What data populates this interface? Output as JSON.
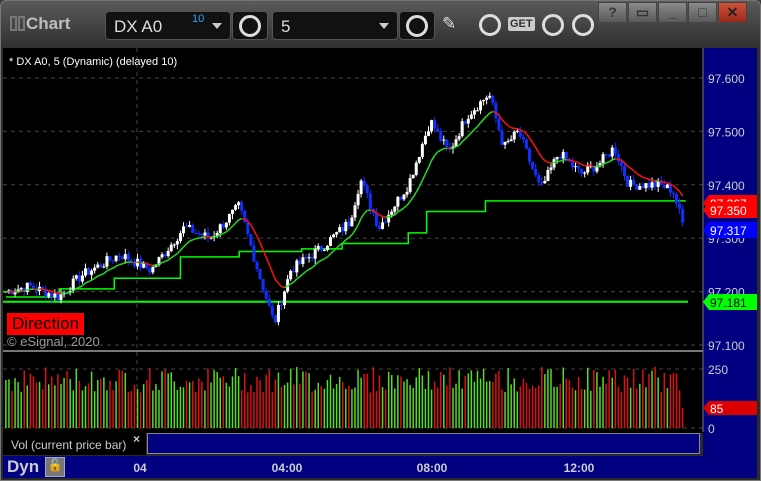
{
  "window": {
    "title": "Chart",
    "symbol": "DX A0",
    "symbol_badge": "10",
    "interval": "5",
    "buttons": [
      "help",
      "restore-down",
      "minimize",
      "maximize",
      "close"
    ],
    "help_label": "?",
    "get_label": "GET"
  },
  "chart": {
    "header": "* DX A0, 5 (Dynamic) (delayed 10)",
    "direction_label": "Direction",
    "copyright": "© eSignal, 2020",
    "vol_label": "Vol (current price bar)",
    "vol_close": "×",
    "dyn_label": "Dyn",
    "price_ticks": [
      "97.600",
      "97.500",
      "97.400",
      "97.300",
      "97.200",
      "97.100"
    ],
    "volume_ticks": [
      "250",
      "0"
    ],
    "time_ticks": [
      "04",
      "04:00",
      "08:00",
      "12:00"
    ],
    "price_labels": [
      {
        "text": "97.367",
        "color": "#ff0000"
      },
      {
        "text": "97.350",
        "color": "#ff0000"
      },
      {
        "text": "97.317",
        "color": "#0000ff"
      },
      {
        "text": "97.181",
        "color": "#00ff00"
      }
    ],
    "volume_label": {
      "text": "85",
      "color": "#dd0000"
    }
  },
  "chart_data": {
    "type": "candlestick",
    "ylim": [
      97.1,
      97.6
    ],
    "vol_ylim": [
      0,
      250
    ],
    "anchors_hours_price": [
      [
        -3.65,
        97.2
      ],
      [
        -3,
        97.21
      ],
      [
        -2.2,
        97.19
      ],
      [
        -1.6,
        97.23
      ],
      [
        -0.55,
        97.27
      ],
      [
        0.3,
        97.24
      ],
      [
        1.2,
        97.32
      ],
      [
        1.9,
        97.3
      ],
      [
        2.7,
        97.36
      ],
      [
        3.25,
        97.23
      ],
      [
        3.65,
        97.14
      ],
      [
        4.1,
        97.24
      ],
      [
        4.9,
        97.28
      ],
      [
        5.7,
        97.33
      ],
      [
        6,
        97.41
      ],
      [
        6.5,
        97.32
      ],
      [
        7.3,
        97.4
      ],
      [
        7.9,
        97.52
      ],
      [
        8.4,
        97.46
      ],
      [
        8.9,
        97.53
      ],
      [
        9.5,
        97.57
      ],
      [
        9.9,
        97.47
      ],
      [
        10.3,
        97.5
      ],
      [
        10.9,
        97.39
      ],
      [
        11.4,
        97.46
      ],
      [
        12,
        97.42
      ],
      [
        12.5,
        97.44
      ],
      [
        12.9,
        97.47
      ],
      [
        13.3,
        97.4
      ],
      [
        14.1,
        97.4
      ],
      [
        14.5,
        97.39
      ],
      [
        14.8,
        97.32
      ]
    ],
    "stop_steps": [
      [
        -3.65,
        97.19
      ],
      [
        -2.2,
        97.205
      ],
      [
        -0.7,
        97.225
      ],
      [
        1.1,
        97.265
      ],
      [
        2.7,
        97.275
      ],
      [
        4.4,
        97.28
      ],
      [
        5.5,
        97.29
      ],
      [
        7.3,
        97.31
      ],
      [
        7.8,
        97.35
      ],
      [
        9.4,
        97.37
      ],
      [
        14.85,
        97.37
      ]
    ],
    "support_level": 97.181,
    "last_volume": 85
  }
}
